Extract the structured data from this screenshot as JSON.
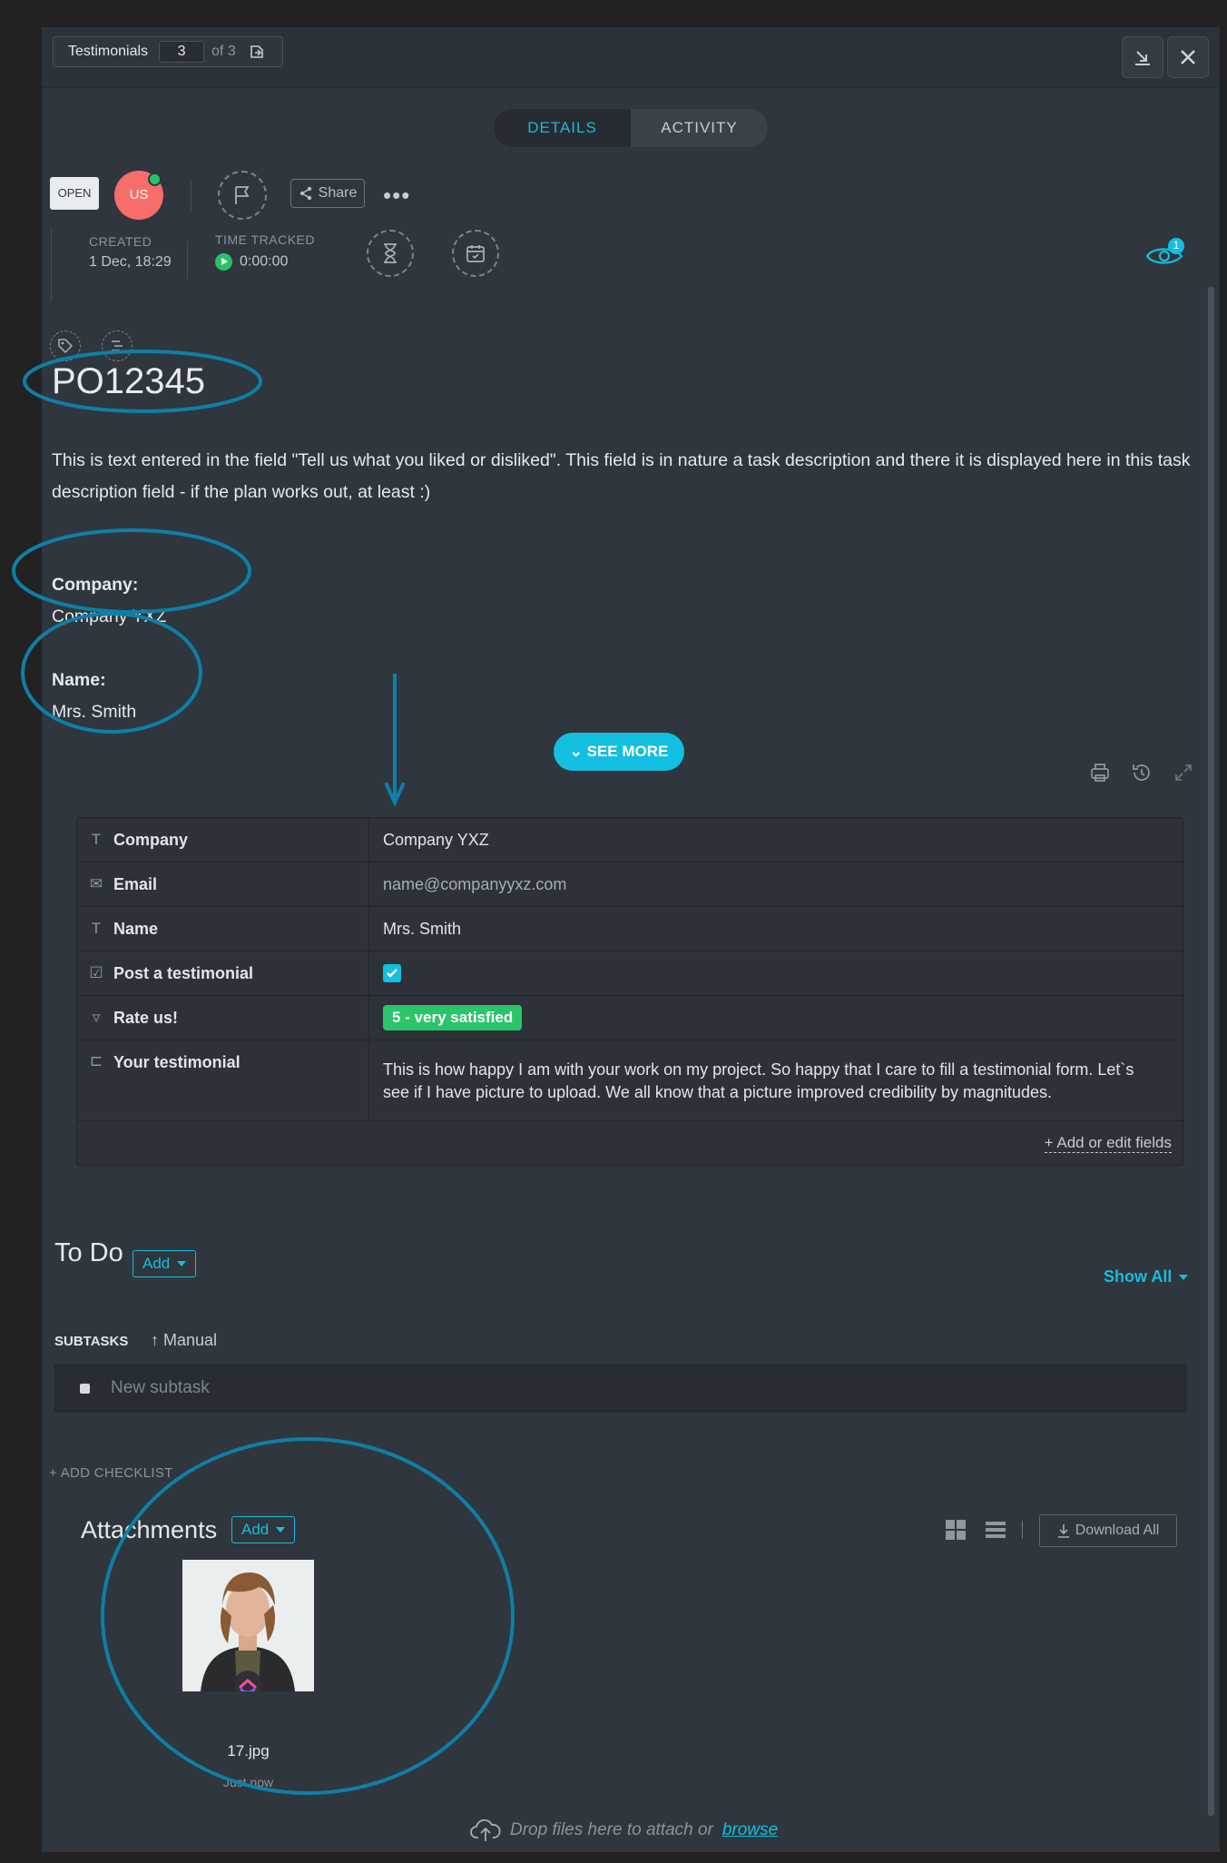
{
  "topbar": {
    "list_name": "Testimonials",
    "index": "3",
    "of_total": "of 3"
  },
  "tabs": [
    {
      "label": "DETAILS",
      "active": true
    },
    {
      "label": "ACTIVITY",
      "active": false
    }
  ],
  "task": {
    "status": "OPEN",
    "assignee_initials": "US",
    "share_label": "Share",
    "created_label": "CREATED",
    "created_value": "1 Dec, 18:29",
    "time_tracked_label": "TIME TRACKED",
    "time_tracked_value": "0:00:00",
    "watchers_count": "1",
    "title": "PO12345",
    "description": "This is text entered in the field \"Tell us what you liked or disliked\". This field is in nature a task description and there it is displayed here in this task description field - if the plan works out, at least :)",
    "company_label": "Company:",
    "company_value": "Company YXZ",
    "name_label": "Name:",
    "name_value": "Mrs. Smith",
    "see_more": "SEE MORE"
  },
  "custom_fields": [
    {
      "icon": "text-field-icon",
      "name": "Company",
      "value": "Company YXZ"
    },
    {
      "icon": "email-icon",
      "name": "Email",
      "value": "name@companyyxz.com"
    },
    {
      "icon": "text-field-icon",
      "name": "Name",
      "value": "Mrs. Smith"
    },
    {
      "icon": "checkbox-icon",
      "name": "Post a testimonial",
      "value": "checked"
    },
    {
      "icon": "dropdown-icon",
      "name": "Rate us!",
      "value": "5 - very satisfied"
    },
    {
      "icon": "long-text-icon",
      "name": "Your testimonial",
      "value": "This is how happy I am with your work on my project. So happy that I care to fill a testimonial form. Let`s see if I have picture to upload. We all know that a picture improved credibility by magnitudes."
    }
  ],
  "fields_footer": "+ Add or edit fields",
  "todo": {
    "title": "To Do",
    "add_label": "Add",
    "show_all": "Show All",
    "subtasks_label": "SUBTASKS",
    "sort_label": "Manual",
    "new_subtask_placeholder": "New subtask",
    "add_checklist": "+ ADD CHECKLIST"
  },
  "attachments": {
    "title": "Attachments",
    "add_label": "Add",
    "download_all": "Download All",
    "files": [
      {
        "name": "17.jpg",
        "time": "Just now"
      }
    ],
    "drop_text": "Drop files here to attach or",
    "browse": "browse"
  },
  "colors": {
    "accent": "#13bfe0",
    "annotation": "#0e7fa6",
    "success": "#2cc46b",
    "avatar": "#f76d6a"
  }
}
